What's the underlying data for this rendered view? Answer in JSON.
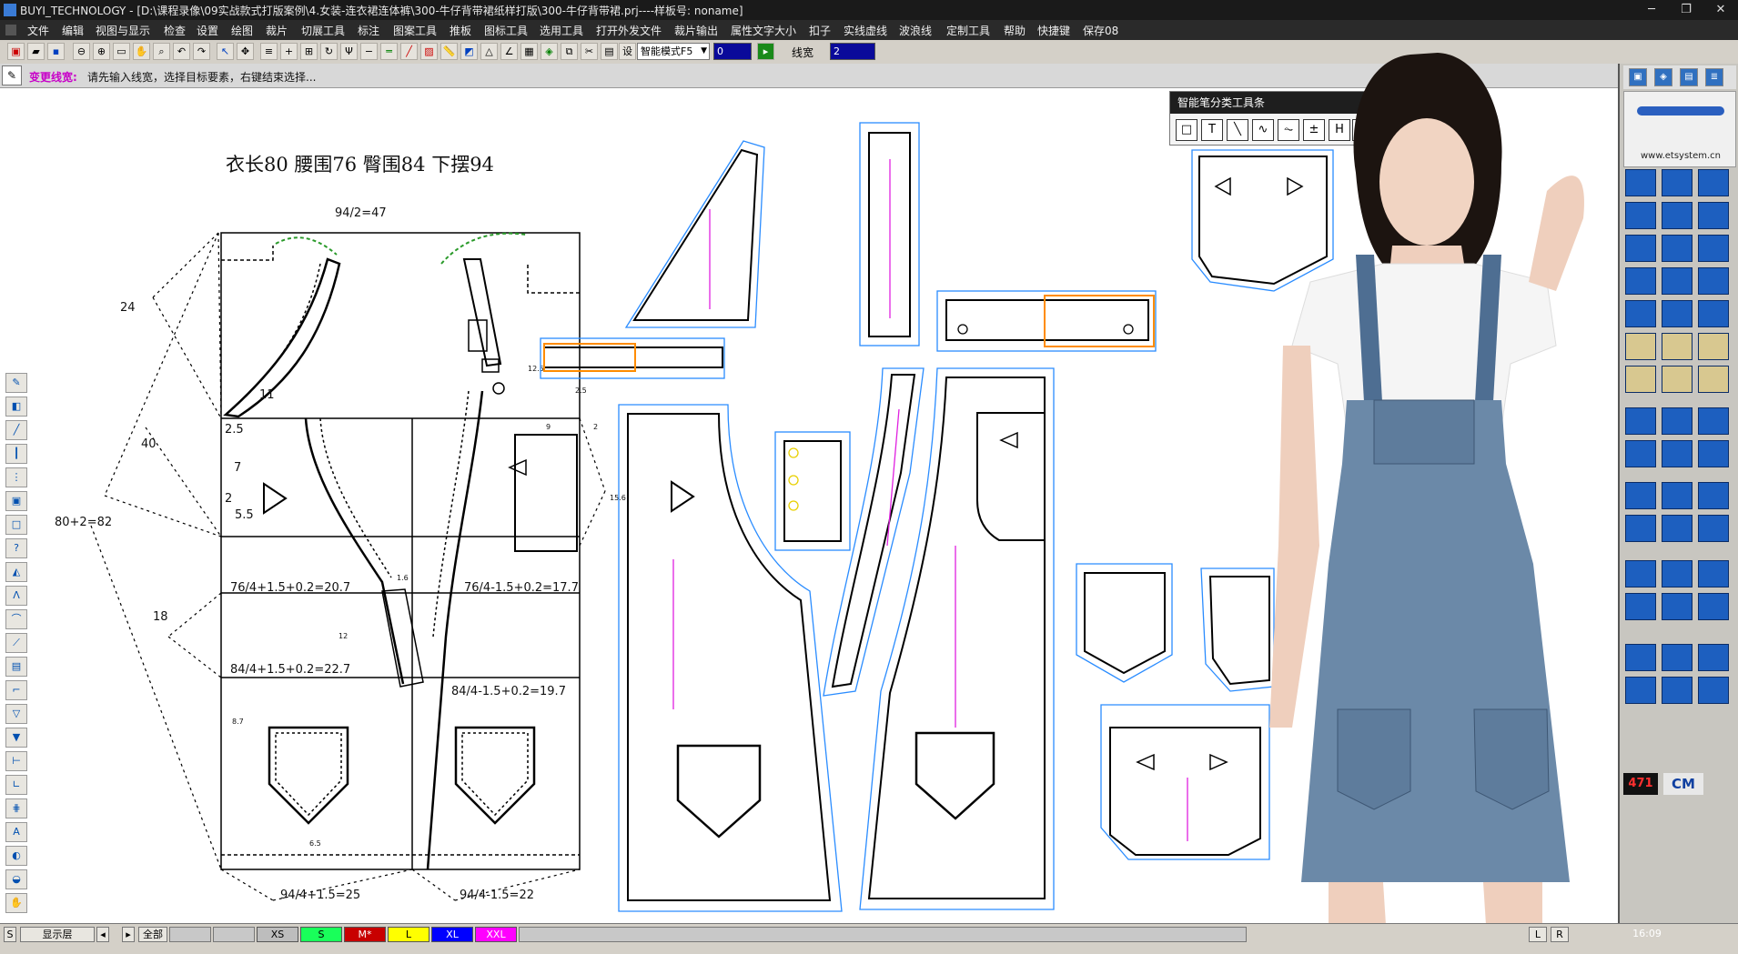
{
  "window": {
    "title": "BUYI_TECHNOLOGY - [D:\\课程录像\\09实战款式打版案例\\4.女装-连衣裙连体裤\\300-牛仔背带裙纸样打版\\300-牛仔背带裙.prj----样板号: noname]"
  },
  "menu": [
    "文件",
    "编辑",
    "视图与显示",
    "检查",
    "设置",
    "绘图",
    "裁片",
    "切展工具",
    "标注",
    "图案工具",
    "推板",
    "图标工具",
    "选用工具",
    "打开外发文件",
    "裁片输出",
    "属性文字大小",
    "扣子",
    "实线虚线",
    "波浪线",
    "定制工具",
    "帮助",
    "快捷键",
    "保存08"
  ],
  "toolbar": {
    "mode_select": "智能模式F5",
    "value_box": "0",
    "line_width_label": "线宽",
    "line_width_value": "2"
  },
  "prompt": {
    "command": "变更线宽:",
    "message": "请先输入线宽，选择目标要素，右键结束选择..."
  },
  "smart_toolbar": {
    "title": "智能笔分类工具条",
    "icons": [
      "□",
      "T",
      "╲",
      "∿",
      "⏦",
      "±",
      "H",
      "_"
    ]
  },
  "drawing": {
    "header": "衣长80   腰围76   臀围84   下摆94",
    "labels": {
      "top_width": "94/2=47",
      "dim_24": "24",
      "dim_40": "40",
      "dim_82": "80+2=82",
      "dim_18": "18",
      "dim_11": "11",
      "dim_25a": "2.5",
      "dim_7": "7",
      "dim_2": "2",
      "dim_55": "5.5",
      "waist_front": "76/4+1.5+0.2=20.7",
      "waist_back": "76/4-1.5+0.2=17.7",
      "hip_front": "84/4+1.5+0.2=22.7",
      "hip_back": "84/4-1.5+0.2=19.7",
      "hem_front": "94/4+1.5=25",
      "hem_back": "94/4-1.5=22",
      "dim_12": "12",
      "dim_87": "8.7",
      "dim_65": "6.5",
      "dim_9": "9",
      "dim_16": "1.6",
      "dim_125": "12.5",
      "dim_156": "15.6",
      "dim_25b": "2.5",
      "dim_2b": "2"
    }
  },
  "layer": {
    "display_label": "显示层",
    "all_label": "全部"
  },
  "sizes": [
    {
      "label": "XS",
      "color": "#bdbdbd"
    },
    {
      "label": "S",
      "color": "#19ff5a"
    },
    {
      "label": "M*",
      "color": "#c80000"
    },
    {
      "label": "L",
      "color": "#ffff00"
    },
    {
      "label": "XL",
      "color": "#0000ff"
    },
    {
      "label": "XXL",
      "color": "#ff00ff"
    }
  ],
  "status_right": {
    "l": "L",
    "r": "R",
    "time": "16:09"
  },
  "right_panel": {
    "website": "www.etsystem.cn",
    "counter": "471",
    "unit": "CM"
  },
  "colors": {
    "pattern_line": "#000000",
    "grain_line": "#e020e0",
    "seam_allowance": "#2a8cff",
    "selected_piece": "#ff8c00",
    "armhole_marks": "#2a9a2a"
  }
}
